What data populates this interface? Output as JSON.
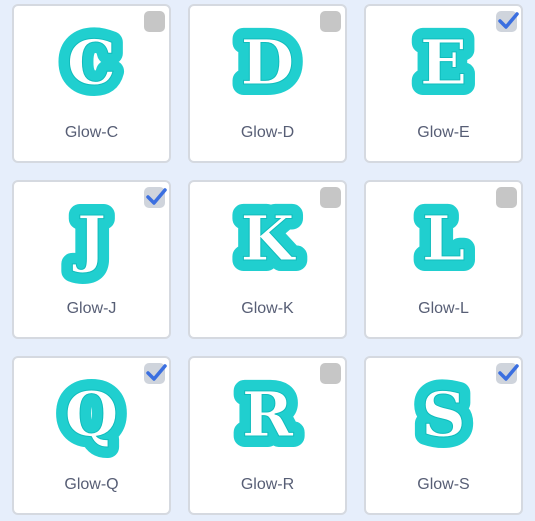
{
  "colors": {
    "glow_fill": "#20cfcf",
    "glow_outline": "#0fbcbc",
    "letter": "#ffffff",
    "check": "#3b6fe0",
    "background": "#e6eefb",
    "card": "#ffffff",
    "label": "#575e75"
  },
  "costumes": [
    {
      "letter": "C",
      "label": "Glow-C",
      "selected": false
    },
    {
      "letter": "D",
      "label": "Glow-D",
      "selected": false
    },
    {
      "letter": "E",
      "label": "Glow-E",
      "selected": true
    },
    {
      "letter": "J",
      "label": "Glow-J",
      "selected": true
    },
    {
      "letter": "K",
      "label": "Glow-K",
      "selected": false
    },
    {
      "letter": "L",
      "label": "Glow-L",
      "selected": false
    },
    {
      "letter": "Q",
      "label": "Glow-Q",
      "selected": true
    },
    {
      "letter": "R",
      "label": "Glow-R",
      "selected": false
    },
    {
      "letter": "S",
      "label": "Glow-S",
      "selected": true
    }
  ]
}
